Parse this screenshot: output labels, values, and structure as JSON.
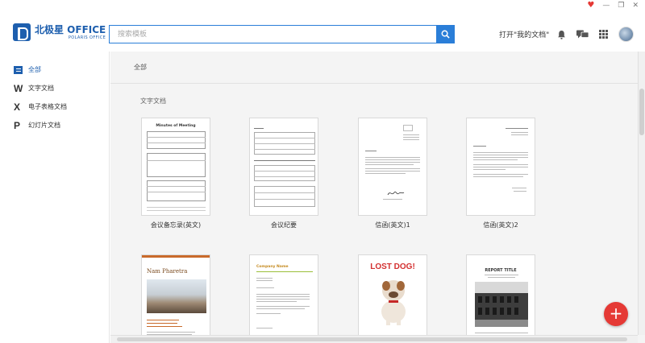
{
  "window": {
    "controls": [
      "♥",
      "—",
      "❐",
      "✕"
    ]
  },
  "brand": {
    "name": "北极星 OFFICE",
    "sub": "POLARIS OFFICE"
  },
  "search": {
    "placeholder": "搜索模板"
  },
  "header": {
    "open_docs": "打开\"我的文档\""
  },
  "sidebar": {
    "items": [
      {
        "icon": "",
        "label": "全部",
        "active": true
      },
      {
        "icon": "W",
        "label": "文字文档"
      },
      {
        "icon": "X",
        "label": "电子表格文档"
      },
      {
        "icon": "P",
        "label": "幻灯片文档"
      }
    ]
  },
  "main": {
    "breadcrumb": "全部",
    "section_title": "文字文档",
    "templates": [
      {
        "label": "会议备忘录(英文)",
        "thumb_title": "Minutes of Meeting"
      },
      {
        "label": "会议纪要",
        "thumb_title": ""
      },
      {
        "label": "信函(英文)1",
        "thumb_title": ""
      },
      {
        "label": "信函(英文)2",
        "thumb_title": ""
      },
      {
        "label": "",
        "thumb_title": "Nam Pharetra"
      },
      {
        "label": "",
        "thumb_title": "Company Name"
      },
      {
        "label": "",
        "thumb_title": "LOST DOG!"
      },
      {
        "label": "",
        "thumb_title": "REPORT TITLE"
      }
    ]
  },
  "fab": {
    "symbol": "+"
  },
  "colors": {
    "brand": "#1e5fae",
    "search_accent": "#2a7ed8",
    "fab": "#e53935"
  }
}
